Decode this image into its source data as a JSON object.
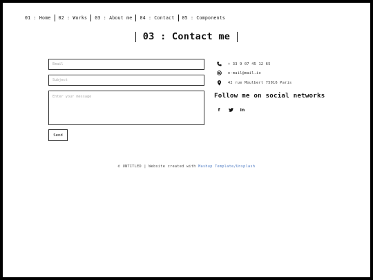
{
  "nav": {
    "items": [
      {
        "label": "01 : Home"
      },
      {
        "label": "02 : Works"
      },
      {
        "label": "03 : About me"
      },
      {
        "label": "04 : Contact"
      },
      {
        "label": "05 : Components"
      }
    ]
  },
  "heading": {
    "title": "03 : Contact me"
  },
  "form": {
    "email_placeholder": "Email",
    "subject_placeholder": "Subject",
    "message_placeholder": "Enter your message",
    "send_label": "Send"
  },
  "contact": {
    "phone": "+ 33 9 07 45 12 65",
    "email": "e-mail@mail.io",
    "address": "42 rue Moulbert 75016 Paris",
    "follow_title": "Follow me on social networks",
    "socials": [
      {
        "icon": "facebook-icon",
        "glyph": "f"
      },
      {
        "icon": "twitter-icon",
        "glyph": "✔"
      },
      {
        "icon": "linkedin-icon",
        "glyph": "in"
      }
    ]
  },
  "footer": {
    "prefix": "© UNTITLED | Website created with ",
    "link_text": "Mashup Template/Unsplash"
  }
}
